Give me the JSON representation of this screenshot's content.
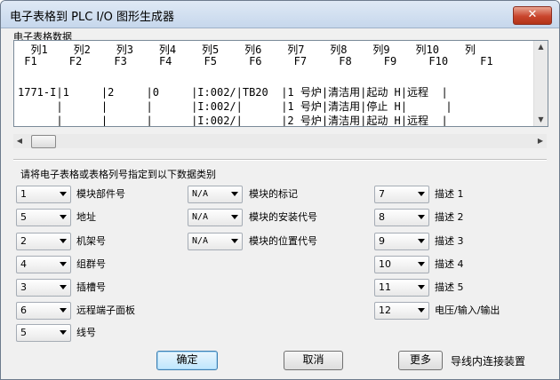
{
  "window": {
    "title": "电子表格到 PLC I/O 图形生成器",
    "close_symbol": "✕"
  },
  "grid": {
    "label": "电子表格数据",
    "lines": [
      "  列1    列2    列3    列4    列5    列6    列7    列8    列9    列10    列",
      " F1     F2     F3     F4     F5     F6     F7     F8     F9     F10     F1",
      "",
      "1771-I|1     |2     |0     |I:002/|TB20  |1 号炉|清洁用|起动 H|远程  |",
      "      |      |      |      |I:002/|      |1 号炉|清洁用|停止 H|      |",
      "      |      |      |      |I:002/|      |2 号炉|清洁用|起动 H|远程  |"
    ]
  },
  "section_label": "请将电子表格或表格列号指定到以下数据类别",
  "col1": [
    {
      "value": "1",
      "label": "模块部件号"
    },
    {
      "value": "5",
      "label": "地址"
    },
    {
      "value": "2",
      "label": "机架号"
    },
    {
      "value": "4",
      "label": "组群号"
    },
    {
      "value": "3",
      "label": "插槽号"
    },
    {
      "value": "6",
      "label": "远程端子面板"
    },
    {
      "value": "5",
      "label": "线号"
    }
  ],
  "col2": [
    {
      "value": "N/A",
      "label": "模块的标记"
    },
    {
      "value": "N/A",
      "label": "模块的安装代号"
    },
    {
      "value": "N/A",
      "label": "模块的位置代号"
    }
  ],
  "col3": [
    {
      "value": "7",
      "label": "描述 1"
    },
    {
      "value": "8",
      "label": "描述 2"
    },
    {
      "value": "9",
      "label": "描述 3"
    },
    {
      "value": "10",
      "label": "描述 4"
    },
    {
      "value": "11",
      "label": "描述 5"
    },
    {
      "value": "12",
      "label": "电压/输入/输出"
    }
  ],
  "buttons": {
    "ok": "确定",
    "cancel": "取消",
    "more": "更多"
  },
  "footer_label": "导线内连接装置"
}
